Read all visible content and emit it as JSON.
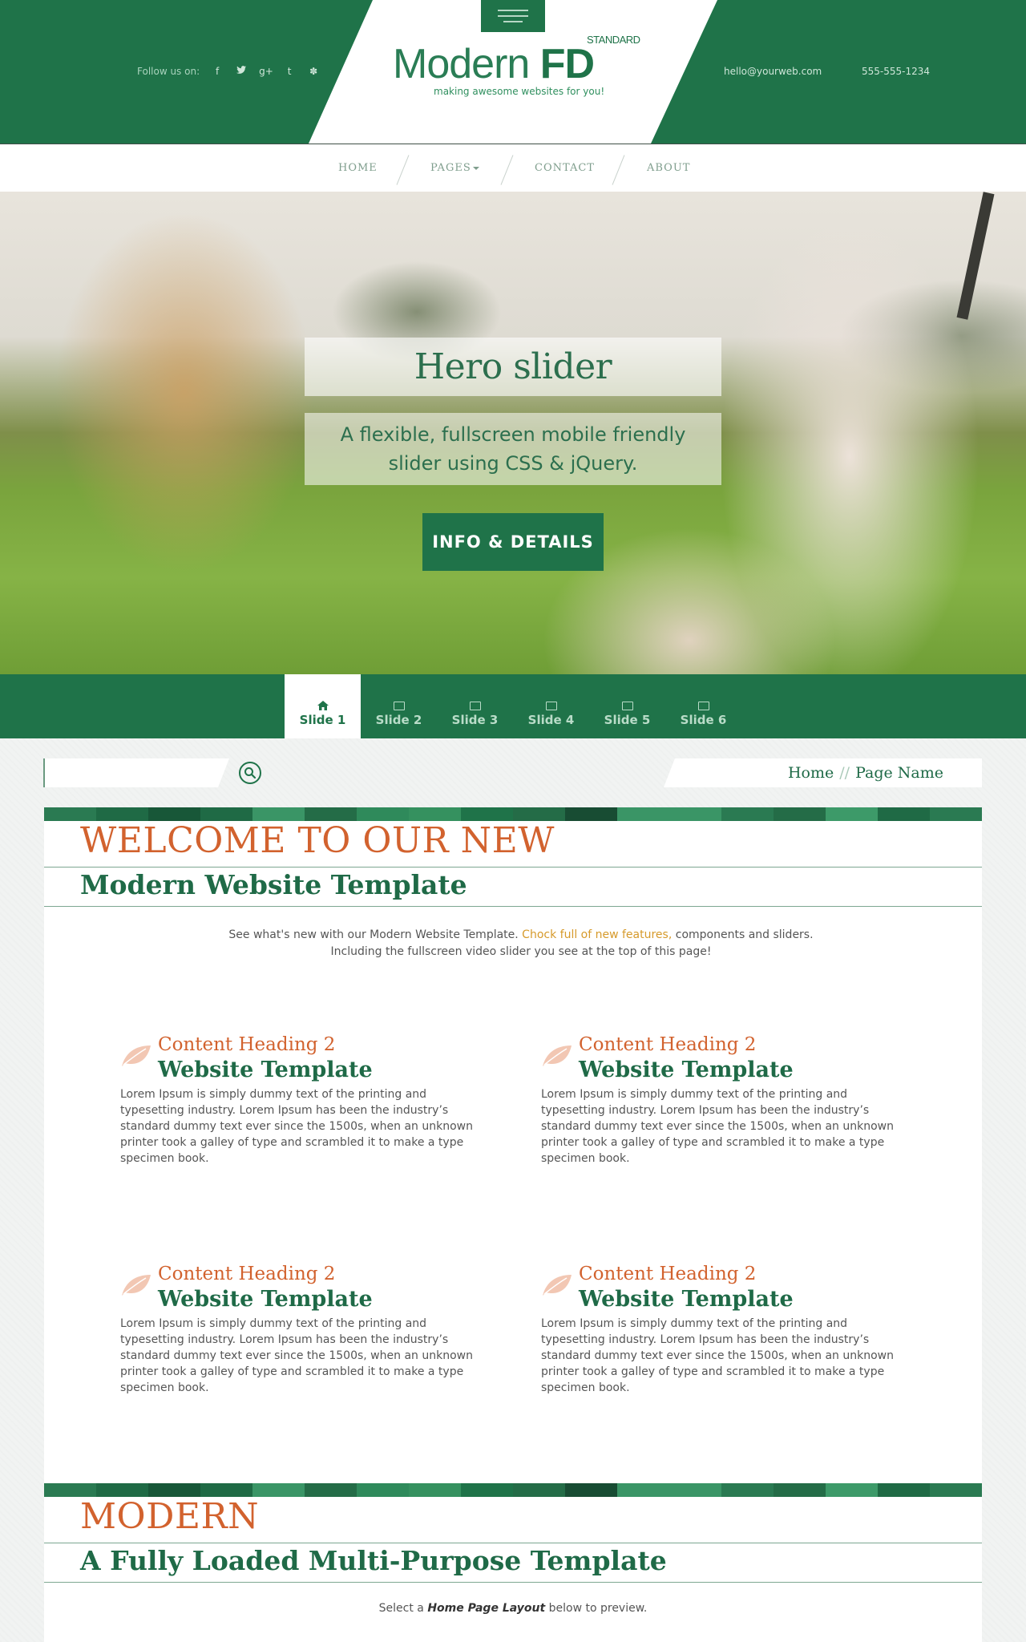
{
  "header": {
    "follow_label": "Follow us on:",
    "social_icons": [
      "facebook-icon",
      "twitter-icon",
      "google-plus-icon",
      "tumblr-icon",
      "yelp-icon"
    ],
    "logo_light": "Modern ",
    "logo_bold": "FD",
    "logo_badge": "STANDARD",
    "tagline": "making awesome websites for you!",
    "email": "hello@yourweb.com",
    "phone": "555-555-1234"
  },
  "nav": {
    "items": [
      {
        "label": "HOME"
      },
      {
        "label": "PAGES"
      },
      {
        "label": "CONTACT"
      },
      {
        "label": "ABOUT"
      }
    ]
  },
  "hero": {
    "title": "Hero slider",
    "subtitle": "A flexible, fullscreen mobile friendly slider using CSS & jQuery.",
    "button": "INFO & DETAILS"
  },
  "slides": {
    "tabs": [
      "Slide 1",
      "Slide 2",
      "Slide 3",
      "Slide 4",
      "Slide 5",
      "Slide 6"
    ],
    "active_index": 0
  },
  "search": {
    "placeholder": ""
  },
  "breadcrumb": {
    "home": "Home",
    "separator": "//",
    "current": "Page Name"
  },
  "welcome": {
    "heading": "WELCOME TO OUR NEW",
    "subheading": "Modern Website Template",
    "intro_pre": "See what's new with our Modern Website Template. ",
    "intro_highlight": "Chock full of new features,",
    "intro_post": " components and sliders.",
    "intro_line2": "Including the fullscreen video slider you see at the top of this page!"
  },
  "features": [
    {
      "small": "Content Heading 2",
      "big": "Website Template",
      "body": "Lorem Ipsum is simply dummy text of the printing and typesetting industry. Lorem Ipsum has been the industry’s standard dummy text ever since the 1500s, when an unknown printer took a galley of type and scrambled it to make a type specimen book."
    },
    {
      "small": "Content Heading 2",
      "big": "Website Template",
      "body": "Lorem Ipsum is simply dummy text of the printing and typesetting industry. Lorem Ipsum has been the industry’s standard dummy text ever since the 1500s, when an unknown printer took a galley of type and scrambled it to make a type specimen book."
    },
    {
      "small": "Content Heading 2",
      "big": "Website Template",
      "body": "Lorem Ipsum is simply dummy text of the printing and typesetting industry. Lorem Ipsum has been the industry’s standard dummy text ever since the 1500s, when an unknown printer took a galley of type and scrambled it to make a type specimen book."
    },
    {
      "small": "Content Heading 2",
      "big": "Website Template",
      "body": "Lorem Ipsum is simply dummy text of the printing and typesetting industry. Lorem Ipsum has been the industry’s standard dummy text ever since the 1500s, when an unknown printer took a galley of type and scrambled it to make a type specimen book."
    }
  ],
  "modern": {
    "heading": "MODERN",
    "subheading": "A Fully Loaded Multi-Purpose Template",
    "preview_pre": "Select a ",
    "preview_em": "Home Page Layout",
    "preview_post": " below to preview."
  },
  "colors": {
    "brand_green": "#1f7349",
    "accent_orange": "#d2622e",
    "highlight_gold": "#d69a2b"
  }
}
